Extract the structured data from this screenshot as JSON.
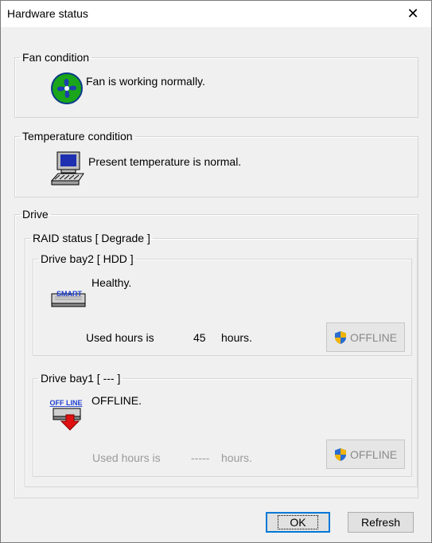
{
  "window": {
    "title": "Hardware status",
    "close_glyph": "✕"
  },
  "fan": {
    "legend": "Fan condition",
    "message": "Fan is working normally.",
    "icon": "fan-icon"
  },
  "temperature": {
    "legend": "Temperature condition",
    "message": "Present temperature is normal.",
    "icon": "computer-icon"
  },
  "drive": {
    "legend": "Drive",
    "raid_status": "RAID status [ Degrade ]",
    "bays": [
      {
        "legend": "Drive bay2 [ HDD ]",
        "status": "Healthy.",
        "icon_text": "SMART",
        "used_label": "Used hours is",
        "hours": "45",
        "hours_unit": "hours.",
        "offline_button": "OFFLINE",
        "disabled_text": false
      },
      {
        "legend": "Drive bay1 [ --- ]",
        "status": "OFFLINE.",
        "icon_text": "OFF LINE",
        "used_label": "Used hours is",
        "hours": "-----",
        "hours_unit": "hours.",
        "offline_button": "OFFLINE",
        "disabled_text": true
      }
    ]
  },
  "buttons": {
    "ok": "OK",
    "refresh": "Refresh"
  },
  "colors": {
    "accent": "#0078d7",
    "fan_blue": "#1e3fae",
    "fan_green": "#1aa51a",
    "arrow_red": "#e01010",
    "shield_blue": "#2a6cd0",
    "shield_yellow": "#f2b400"
  }
}
